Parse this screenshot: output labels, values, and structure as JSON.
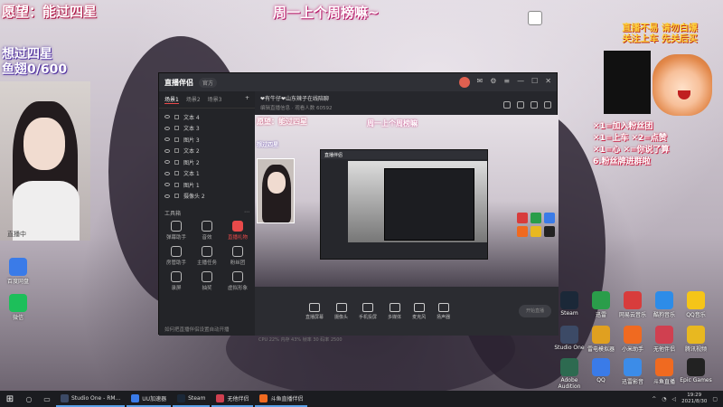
{
  "overlay": {
    "wish_line": "愿望：能过四星",
    "wish_sub_1": "想过四星",
    "wish_sub_2": "鱼翅0/600",
    "weekly_rank": "周一上个周榜嘛~",
    "cam_label": "直播中"
  },
  "right_panel": {
    "title_1": "直播不易 请勿白嫖",
    "title_2": "关注上车 先关后买",
    "rules": [
      "✕1=加入粉丝团",
      "✕1=上车  ✕2=点赞",
      "✕1=心  ✕=你说了算",
      "6.粉丝牌进群啦"
    ]
  },
  "app_window": {
    "logo": "直播伴侣",
    "pill": "官方",
    "sidebar_tabs": [
      "场景1",
      "场景2",
      "场景3"
    ],
    "layers": [
      "文本 4",
      "文本 3",
      "图片 3",
      "文本 2",
      "图片 2",
      "文本 1",
      "图片 1",
      "摄像头 2"
    ],
    "tools_header": "工具箱",
    "tools": [
      {
        "label": "弹幕助手",
        "hot": false
      },
      {
        "label": "音效",
        "hot": false
      },
      {
        "label": "直播礼物",
        "hot": true
      },
      {
        "label": "房管助手",
        "hot": false
      },
      {
        "label": "主播任务",
        "hot": false
      },
      {
        "label": "粉丝团",
        "hot": false
      },
      {
        "label": "录屏",
        "hot": false
      },
      {
        "label": "抽奖",
        "hot": false
      },
      {
        "label": "虚拟形象",
        "hot": false
      }
    ],
    "sidebar_footer": "如何把直播伴侣设置自动开播",
    "main_title": "❤有牛仔❤山东辣子在线陪聊",
    "main_subtitle": "编辑直播信息 · 观看人数 60592",
    "preview": {
      "wish": "愿望：能过四星",
      "weekly": "周一上个周榜嘛",
      "wish_sub": "想过四星"
    },
    "bottom_controls": [
      "直播屏幕",
      "摄像头",
      "手机投屏",
      "多媒体",
      "麦克风",
      "扬声器"
    ],
    "live_button": "开始直播",
    "status": "CPU 22%  内存 43%  帧率 30  码率 2500"
  },
  "desktop_icons_left": [
    {
      "label": "百度网盘",
      "color": "#3a7be8"
    },
    {
      "label": "微信",
      "color": "#1dbf5a"
    }
  ],
  "desktop_icons_right": [
    {
      "label": "Steam",
      "color": "#1b2838"
    },
    {
      "label": "迅雷",
      "color": "#2a9d4a"
    },
    {
      "label": "网易云音乐",
      "color": "#d83c3c"
    },
    {
      "label": "酷狗音乐",
      "color": "#2d8ce8"
    },
    {
      "label": "QQ音乐",
      "color": "#f5c518"
    },
    {
      "label": "Studio One",
      "color": "#3c4a66"
    },
    {
      "label": "雷电模拟器",
      "color": "#e0a020"
    },
    {
      "label": "小米助手",
      "color": "#f06a20"
    },
    {
      "label": "无他伴侣",
      "color": "#d04050"
    },
    {
      "label": "腾讯视频",
      "color": "#e8b820"
    },
    {
      "label": "Adobe Audition",
      "color": "#2d6a50"
    },
    {
      "label": "QQ",
      "color": "#3a7be8"
    },
    {
      "label": "迅雷影音",
      "color": "#3c8ce8"
    },
    {
      "label": "斗鱼直播",
      "color": "#f06a20"
    },
    {
      "label": "Epic Games",
      "color": "#222222"
    }
  ],
  "taskbar": {
    "apps": [
      {
        "label": "Studio One - RM...",
        "color": "#3c4a66"
      },
      {
        "label": "UU加速器",
        "color": "#3a7be8"
      },
      {
        "label": "Steam",
        "color": "#1b2838"
      },
      {
        "label": "无他伴侣",
        "color": "#d04050"
      },
      {
        "label": "斗鱼直播伴侣",
        "color": "#f06a20"
      }
    ],
    "time": "19:29",
    "date": "2021/8/30"
  },
  "colors": {
    "accent": "#e94a4a",
    "taskbar_underline": "#5aa0e8"
  }
}
